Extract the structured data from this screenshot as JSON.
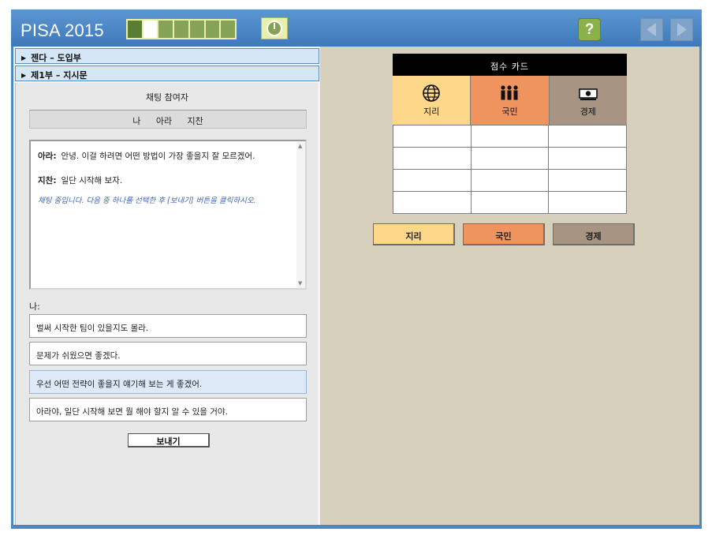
{
  "header": {
    "app_title": "PISA 2015",
    "progress": {
      "segments": 7,
      "completed": 1,
      "current": 2
    },
    "help_label": "?",
    "icons": [
      "clock-icon",
      "question-icon",
      "back-arrow-icon",
      "next-arrow-icon"
    ]
  },
  "sections": [
    {
      "label": "젠다 – 도입부"
    },
    {
      "label": "제1부 – 지시문"
    }
  ],
  "chat": {
    "participants_title": "채팅 참여자",
    "participants": "나 아라 지찬",
    "messages": [
      {
        "speaker": "아라:",
        "text": "안녕. 이걸 하려면 어떤 방법이 가장 좋을지 잘 모르겠어."
      },
      {
        "speaker": "지찬:",
        "text": "일단 시작해 보자."
      }
    ],
    "instruction": "채팅 중입니다. 다음 중 하나를 선택한 후 [보내기] 버튼을 클릭하시오.",
    "me_label": "나:",
    "options": [
      {
        "text": "벌써 시작한 팀이 있을지도 몰라.",
        "selected": false
      },
      {
        "text": "문제가 쉬웠으면 좋겠다.",
        "selected": false
      },
      {
        "text": "우선 어떤 전략이 좋을지 얘기해 보는 게 좋겠어.",
        "selected": true
      },
      {
        "text": "아라야, 일단 시작해 보면 뭘 해야 할지 알 수 있을 거야.",
        "selected": false
      }
    ],
    "send_label": "보내기"
  },
  "score_card": {
    "title": "점수 카드",
    "categories": [
      {
        "label": "지리",
        "icon": "globe-icon",
        "color": "#fdd88b"
      },
      {
        "label": "국민",
        "icon": "people-icon",
        "color": "#f0945f"
      },
      {
        "label": "경제",
        "icon": "money-icon",
        "color": "#a89482"
      }
    ],
    "row_count": 4,
    "buttons": [
      {
        "label": "지리",
        "color": "#fdd88b"
      },
      {
        "label": "국민",
        "color": "#f0945f"
      },
      {
        "label": "경제",
        "color": "#a89482"
      }
    ]
  },
  "colors": {
    "header_blue": "#4a87c6",
    "progress_green": "#86a257",
    "panel_tan": "#d6d0bd",
    "selected_option": "#dde9f7",
    "instruction_blue": "#3c66b8"
  }
}
